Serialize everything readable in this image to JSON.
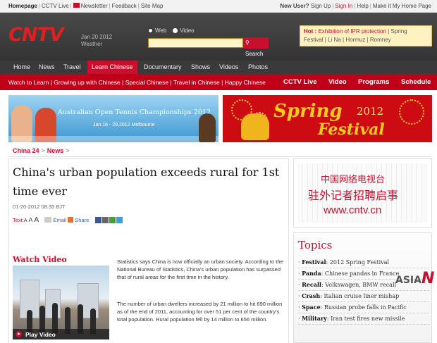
{
  "topbar": {
    "left_links": [
      "Homepage",
      "CCTV Live",
      "Newsletter",
      "Feedback",
      "Site Map"
    ],
    "new_user": "New User?",
    "sign_up": "Sign Up",
    "sign_in": "Sign In",
    "help": "Help",
    "make_home": "Make it My Home Page"
  },
  "header": {
    "logo": "CNTV",
    "date": "Jan 20 2012",
    "weather": "Weather",
    "search_options": [
      "Web",
      "Video"
    ],
    "search_value": "",
    "search_button": "Search",
    "hot_label": "Hot :",
    "hot_items": [
      "Exhibition of IPR protection",
      "Spring Festival",
      "Li Na",
      "Hormuz",
      "Romney"
    ]
  },
  "mainnav": [
    "Home",
    "News",
    "Travel",
    "Learn Chinese",
    "Documentary",
    "Shows",
    "Videos",
    "Photos"
  ],
  "subnav": {
    "links": [
      "Watch to Learn",
      "Growing up with Chinese",
      "Special Chinese",
      "Travel in Chinese",
      "Happy Chinese"
    ],
    "big": [
      "CCTV Live",
      "Video",
      "Programs",
      "Schedule"
    ]
  },
  "banners": {
    "tennis_title": "Australian Open Tennis Championships 2012",
    "tennis_dates": "Jan.16 - 29,2012   Melbourne",
    "spring_word": "Spring",
    "spring_year": "2012",
    "festival_word": "Festival"
  },
  "breadcrumb": [
    "China 24",
    "News"
  ],
  "article": {
    "headline": "China's urban population exceeds rural for 1st time ever",
    "dateline": "01-20-2012 08:35 BJT",
    "text_label": "Text:",
    "email": "Email",
    "share": "Share",
    "watch_video": "Watch Video",
    "play_video": "Play Video",
    "paragraph1": "Statistics says China is now officially an urban society. According to the National Bureau of Statistics, China's urban population has surpassed that of rural areas for the first time in the history.",
    "paragraph2": "The number of urban dwellers increased by 21 million to hit 690 million as of the end of 2011, accounting for over 51 per cent of the country's total population. Rural population fell by 14 million to 656 million."
  },
  "ad": {
    "line1": "中国网络电视台",
    "line2": "驻外记者招聘启事",
    "url": "www.cntv.cn"
  },
  "topics": {
    "title": "Topics",
    "items": [
      {
        "k": "Festival",
        "v": "2012 Spring Festival"
      },
      {
        "k": "Panda",
        "v": "Chinese pandas in France"
      },
      {
        "k": "Recall",
        "v": "Volkswagen, BMW recall"
      },
      {
        "k": "Crash",
        "v": "Italian cruise liner mishap"
      },
      {
        "k": "Space",
        "v": "Russian probe falls in Pacific"
      },
      {
        "k": "Military",
        "v": "Iran test fires new missile"
      }
    ]
  },
  "asian_logo": {
    "a": "ASIA",
    "n": "N"
  }
}
